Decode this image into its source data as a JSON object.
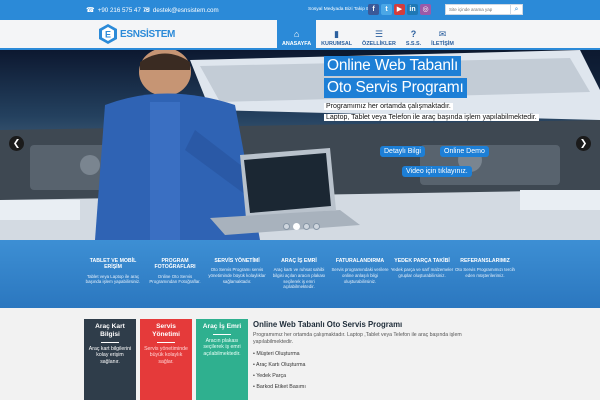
{
  "topbar": {
    "phone": "+90 216 575 47 78",
    "email": "destek@esnsistem.com",
    "social_label": "Sosyal Medyada Bizi Takip Edin",
    "social_icons": [
      {
        "name": "facebook-icon",
        "glyph": "f",
        "color": "#3b5998"
      },
      {
        "name": "twitter-icon",
        "glyph": "t",
        "color": "#4ba7e6"
      },
      {
        "name": "youtube-icon",
        "glyph": "▶",
        "color": "#d43c3c"
      },
      {
        "name": "linkedin-icon",
        "glyph": "in",
        "color": "#1f78b4"
      },
      {
        "name": "instagram-icon",
        "glyph": "◎",
        "color": "#9b5aa8"
      }
    ],
    "search_placeholder": "Site içinde arama yap"
  },
  "header": {
    "logo_text": "ESNSİSTEM",
    "nav": [
      {
        "label": "ANASAYFA",
        "icon": "⌂",
        "icon_name": "home-icon",
        "active": true
      },
      {
        "label": "KURUMSAL",
        "icon": "▮",
        "icon_name": "building-icon",
        "active": false
      },
      {
        "label": "ÖZELLİKLER",
        "icon": "☰",
        "icon_name": "list-icon",
        "active": false
      },
      {
        "label": "S.S.S.",
        "icon": "?",
        "icon_name": "question-icon",
        "active": false
      },
      {
        "label": "İLETİŞİM",
        "icon": "✉",
        "icon_name": "envelope-icon",
        "active": false
      }
    ]
  },
  "hero": {
    "title_line1": "Online Web Tabanlı",
    "title_line2": "Oto Servis Programı",
    "subtitle_line1": "Programımız her ortamda çalışmaktadır.",
    "subtitle_line2": "Laptop, Tablet veya Telefon ile araç başında işlem yapılabilmektedir.",
    "btn_detail": "Detaylı Bilgi",
    "btn_demo": "Online Demo",
    "btn_video": "Video için tıklayınız.",
    "slides": 4,
    "active_slide": 1
  },
  "features": [
    {
      "title": "TABLET VE MOBİL ERİŞİM",
      "text": "Tablet veya Laptop ile araç başında işlem yapabilirsiniz."
    },
    {
      "title": "PROGRAM FOTOĞRAFLARI",
      "text": "Online Oto Servis Programından Fotoğraflar."
    },
    {
      "title": "SERVİS YÖNETİMİ",
      "text": "Oto Servis Programı servis yönetiminde büyük kolaylıklar sağlamaktadır."
    },
    {
      "title": "ARAÇ İŞ EMRİ",
      "text": "Araç kartı ve ruhsat sahibi bilgisi açılan aracın plakası seçilerek iş emri açılabilmektedir."
    },
    {
      "title": "FATURALANDIRMA",
      "text": "Servis programındaki verilere online anlaşılı bilgi oluşturabilirsiniz."
    },
    {
      "title": "YEDEK PARÇA TAKİBİ",
      "text": "Yedek parça ve sarf malzemeler gruplar oluşturabilirsiniz."
    },
    {
      "title": "REFERANSLARIMIZ",
      "text": "Oto Servis Programımızı tercih eden müşterilerimiz."
    }
  ],
  "cards": [
    {
      "title": "Araç Kart Bilgisi",
      "text": "Araç kart bilgilerini kolay erişim sağlanır."
    },
    {
      "title": "Servis Yönetimi",
      "text": "Servis yönetiminde büyük kolaylık sağlar."
    },
    {
      "title": "Araç İş Emri",
      "text": "Aracın plakası seçilerek iş emri açılabilmektedir."
    }
  ],
  "info": {
    "title": "Online Web Tabanlı Oto Servis Programı",
    "description": "Programımız her ortamda çalışmaktadır. Laptop ,Tablet veya Telefon ile araç başında işlem yapılabilmektedir.",
    "items": [
      "Müşteri Oluşturma",
      "Araç Kartı Oluşturma",
      "Yedek Parça",
      "Barkod Etiket Basımı"
    ]
  },
  "colors": {
    "brand_blue": "#2b8ad8",
    "card_dark": "#2f3d4a",
    "card_red": "#e53a3a",
    "card_green": "#2fb08f"
  }
}
